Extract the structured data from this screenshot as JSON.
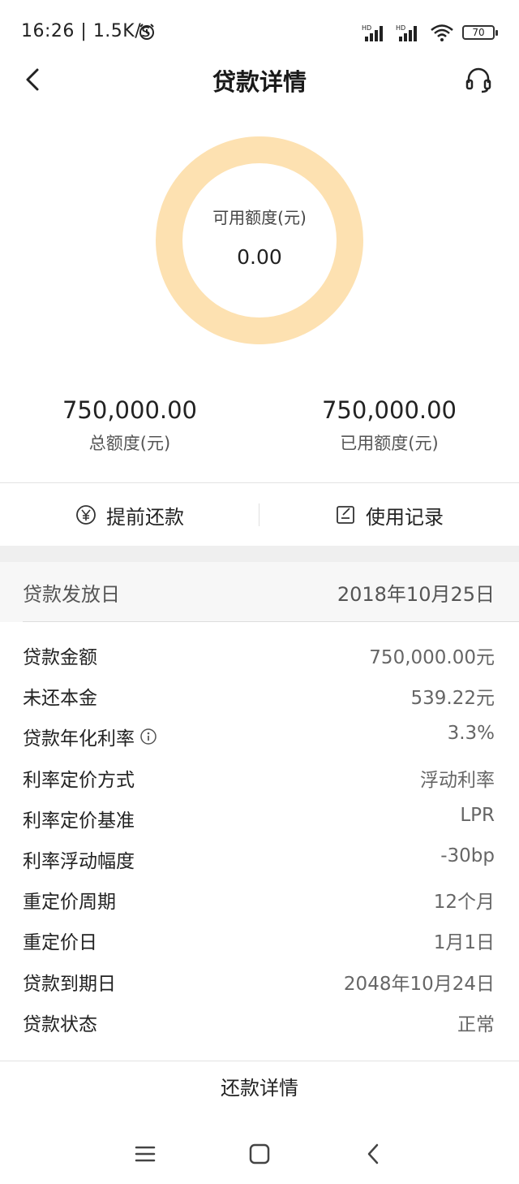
{
  "status_bar": {
    "time": "16:26",
    "net_speed": "1.5K/s",
    "battery": "70",
    "icons": [
      "alarm-icon",
      "signal-hd-icon",
      "signal-hd-icon",
      "wifi-icon",
      "battery-icon"
    ]
  },
  "nav": {
    "title": "贷款详情",
    "back_icon": "chevron-left-icon",
    "service_icon": "headset-icon"
  },
  "credit": {
    "available_label": "可用额度(元)",
    "available_value": "0.00",
    "total_amount": "750,000.00",
    "total_label": "总额度(元)",
    "used_amount": "750,000.00",
    "used_label": "已用额度(元)",
    "ring_color": "#fde1b1"
  },
  "actions": {
    "prepay_label": "提前还款",
    "prepay_icon": "yen-coin-icon",
    "records_label": "使用记录",
    "records_icon": "edit-note-icon"
  },
  "issue": {
    "label": "贷款发放日",
    "value": "2018年10月25日"
  },
  "details": [
    {
      "label": "贷款金额",
      "value": "750,000.00元"
    },
    {
      "label": "未还本金",
      "value": "539.22元"
    },
    {
      "label": "贷款年化利率",
      "value": "3.3%"
    },
    {
      "label": "利率定价方式",
      "value": "浮动利率"
    },
    {
      "label": "利率定价基准",
      "value": "LPR"
    },
    {
      "label": "利率浮动幅度",
      "value": "-30bp"
    },
    {
      "label": "重定价周期",
      "value": "12个月"
    },
    {
      "label": "重定价日",
      "value": "1月1日"
    },
    {
      "label": "贷款到期日",
      "value": "2048年10月24日"
    },
    {
      "label": "贷款状态",
      "value": "正常"
    }
  ],
  "footer": {
    "repay_detail": "还款详情"
  },
  "system_nav": {
    "icons": [
      "menu-icon",
      "home-square-icon",
      "back-icon"
    ]
  }
}
